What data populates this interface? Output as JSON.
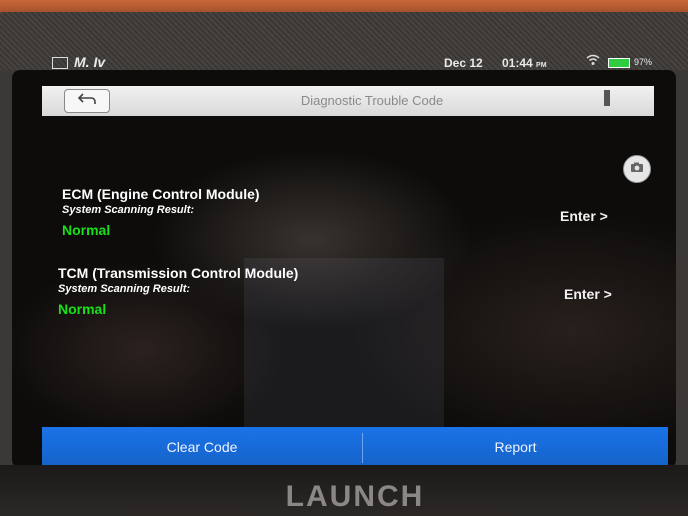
{
  "status_bar": {
    "left_text": "M. Iv",
    "date": "Dec 12",
    "time": "01:44",
    "time_suffix": "PM",
    "battery_percent": "97%",
    "icons": [
      "gallery-icon",
      "wifi-icon",
      "battery-icon"
    ]
  },
  "title_bar": {
    "back_icon": "back-arrow-icon",
    "title": "Diagnostic Trouble Code",
    "camera_icon": "camera-icon"
  },
  "modules": [
    {
      "name": "ECM (Engine Control Module)",
      "scan_label": "System Scanning Result:",
      "result": "Normal",
      "enter_label": "Enter >"
    },
    {
      "name": "TCM (Transmission Control Module)",
      "scan_label": "System Scanning Result:",
      "result": "Normal",
      "enter_label": "Enter >"
    }
  ],
  "bottom_bar": {
    "clear_label": "Clear Code",
    "report_label": "Report"
  },
  "device": {
    "brand": "LAUNCH"
  },
  "colors": {
    "accent": "#1a73e8",
    "normal_status": "#19e119",
    "battery": "#2ecc40"
  }
}
